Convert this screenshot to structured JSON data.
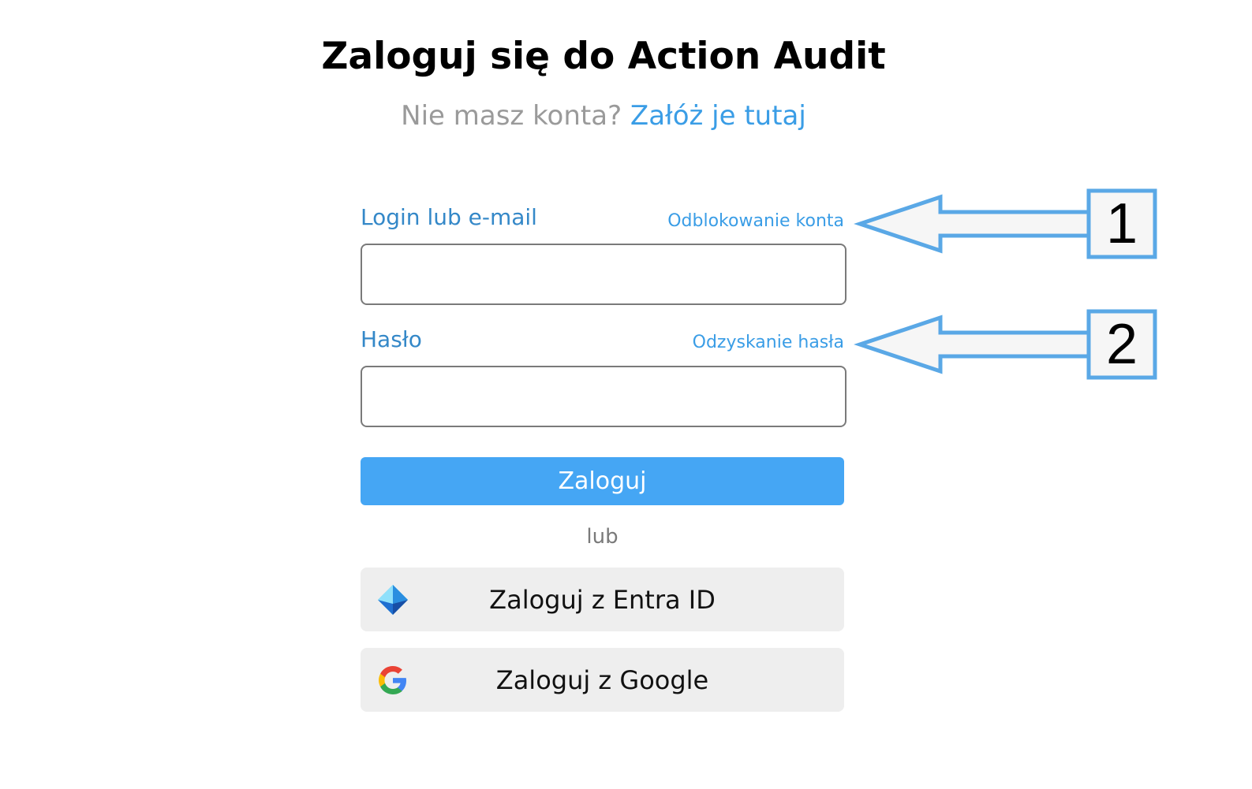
{
  "header": {
    "title": "Zaloguj się do Action Audit",
    "subtitle_text": "Nie masz konta?",
    "signup_link": "Załóż je tutaj"
  },
  "form": {
    "login": {
      "label": "Login lub e-mail",
      "link": "Odblokowanie konta",
      "value": "",
      "placeholder": ""
    },
    "password": {
      "label": "Hasło",
      "link": "Odzyskanie hasła",
      "value": "",
      "placeholder": ""
    },
    "submit_label": "Zaloguj",
    "or_text": "lub"
  },
  "sso": [
    {
      "label": "Zaloguj z Entra ID",
      "icon": "entra-id-icon"
    },
    {
      "label": "Zaloguj z Google",
      "icon": "google-icon"
    }
  ],
  "annotations": [
    {
      "number": "1"
    },
    {
      "number": "2"
    }
  ],
  "colors": {
    "accent": "#45a6f4",
    "link": "#3a9de6",
    "label": "#3488c8",
    "callout_border": "#5aa8e6"
  }
}
